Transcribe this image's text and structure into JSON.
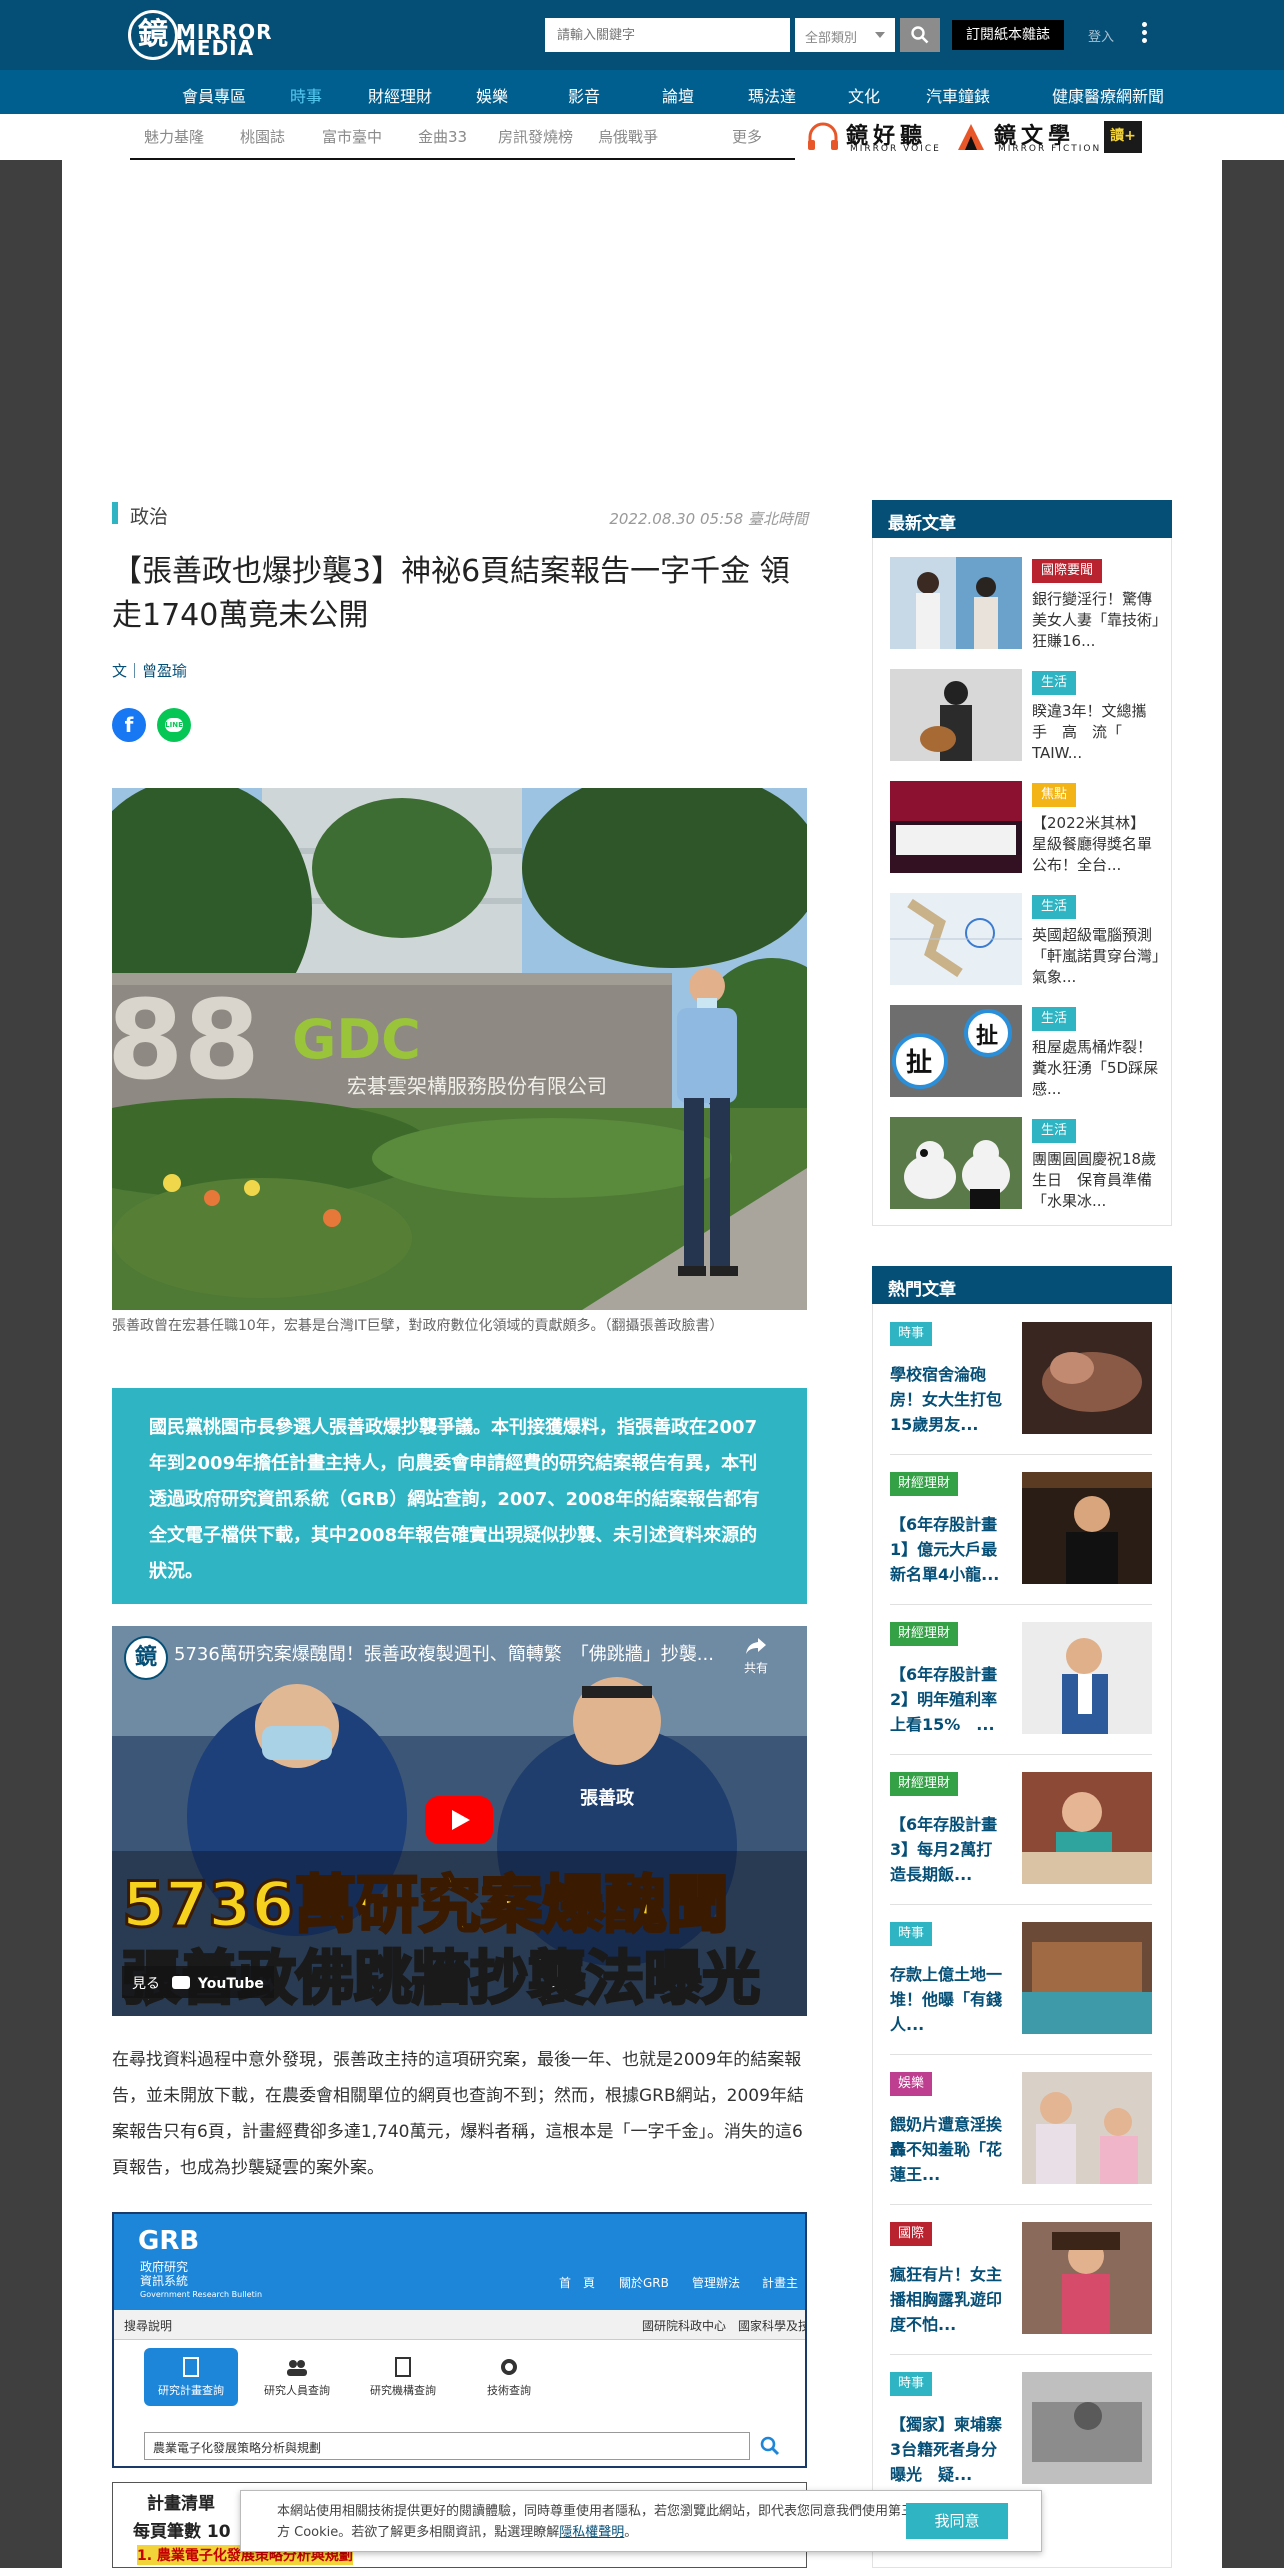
{
  "header": {
    "logo_glyph": "鏡",
    "logo_text": "MIRROR MEDIA",
    "search_placeholder": "請輸入關鍵字",
    "category_value": "全部類別",
    "subscribe_label": "訂閱紙本雜誌",
    "login_label": "登入",
    "icons": {
      "search": "search-icon",
      "more": "more-vertical-icon"
    },
    "colors": {
      "bar": "#054f77",
      "nav": "#015f8f",
      "accent": "#2eb4c3",
      "active_nav": "#55c8f0"
    }
  },
  "category_nav": [
    {
      "label": "會員專區",
      "active": false
    },
    {
      "label": "時事",
      "active": true
    },
    {
      "label": "財經理財",
      "active": false
    },
    {
      "label": "娛樂",
      "active": false
    },
    {
      "label": "影音",
      "active": false
    },
    {
      "label": "論壇",
      "active": false
    },
    {
      "label": "瑪法達",
      "active": false
    },
    {
      "label": "文化",
      "active": false
    },
    {
      "label": "汽車鐘錶",
      "active": false
    },
    {
      "label": "健康醫療網新聞",
      "active": false
    }
  ],
  "sub_nav": [
    "魅力基隆",
    "桃園誌",
    "富市臺中",
    "金曲33",
    "房訊發燒榜",
    "烏俄戰爭",
    "更多"
  ],
  "brands": [
    {
      "zh": "鏡好聽",
      "en": "MIRROR VOICE",
      "icon": "headphones-icon"
    },
    {
      "zh": "鏡文學",
      "en": "MIRROR FICTION",
      "icon": "book-icon"
    }
  ],
  "plus_label": "讀+",
  "article": {
    "section": "政治",
    "published": "2022.08.30 05:58 臺北時間",
    "title": "【張善政也爆抄襲3】神祕6頁結案報告一字千金 領走1740萬竟未公開",
    "byline": "文｜曾盈瑜",
    "share": {
      "facebook": "facebook-icon",
      "line": "line-icon",
      "line_text": "LINE"
    },
    "hero_sign_text": "宏碁雲架構服務股份有限公司",
    "hero_logo_text": "GDC",
    "hero_number": "88",
    "caption": "張善政曾在宏碁任職10年，宏碁是台灣IT巨擘，對政府數位化領域的貢獻頗多。（翻攝張善政臉書）",
    "summary": "國民黨桃園市長參選人張善政爆抄襲爭議。本刊接獲爆料，指張善政在2007年到2009年擔任計畫主持人，向農委會申請經費的研究結案報告有異，本刊透過政府研究資訊系統（GRB）網站查詢，2007、2008年的結案報告都有全文電子檔供下載，其中2008年報告確實出現疑似抄襲、未引述資料來源的狀況。",
    "video": {
      "title": "5736萬研究案爆醜聞！張善政複製週刊、簡轉繁　「佛跳牆」抄襲...",
      "share_label": "共有",
      "headline_1": "5736萬研究案爆醜聞",
      "headline_2": "張善政佛跳牆抄襲法曝光",
      "watch_label": "見る",
      "youtube_label": "YouTube",
      "shirt_text": "張善政"
    },
    "paragraph": "在尋找資料過程中意外發現，張善政主持的這項研究案，最後一年、也就是2009年的結案報告，並未開放下載，在農委會相關單位的網頁也查詢不到；然而，根據GRB網站，2009年結案報告只有6頁，計畫經費卻多達1,740萬元，爆料者稱，這根本是「一字千金」。消失的這6頁報告，也成為抄襲疑雲的案外案。",
    "grb": {
      "logo": "GRB",
      "subtitle_1": "政府研究",
      "subtitle_2": "資訊系統",
      "subtitle_3": "Government Research Bulletin",
      "nav": [
        "首　頁",
        "關於GRB",
        "管理辦法",
        "計畫主"
      ],
      "bar_left": "搜尋說明",
      "bar_right": "國研院科政中心　國家科學及技",
      "tabs": [
        "研究計畫查詢",
        "研究人員查詢",
        "研究機構查詢",
        "技術查詢"
      ],
      "field_value": "農業電子化發展策略分析與規劃",
      "row_1": "計畫清單",
      "row_2": "每頁筆數 10",
      "row_3": "1. 農業電子化發展策略分析與規劃"
    }
  },
  "sidebar": {
    "latest_heading": "最新文章",
    "latest": [
      {
        "badge": "國際要聞",
        "color": "#b8232f",
        "title": "銀行變淫行！驚傳美女人妻「靠技術」狂賺16..."
      },
      {
        "badge": "生活",
        "color": "#2eb4c3",
        "title": "睽違3年！文總攜手　高　流「　TAIW..."
      },
      {
        "badge": "焦點",
        "color": "#f3b418",
        "title": "【2022米其林】星級餐廳得獎名單公布！全台..."
      },
      {
        "badge": "生活",
        "color": "#2eb4c3",
        "title": "英國超級電腦預測「軒嵐諾貫穿台灣」　氣象..."
      },
      {
        "badge": "生活",
        "color": "#2eb4c3",
        "title": "租屋處馬桶炸裂！糞水狂湧「5D踩屎感..."
      },
      {
        "badge": "生活",
        "color": "#2eb4c3",
        "title": "團團圓圓慶祝18歲生日　保育員準備「水果冰..."
      }
    ],
    "hot_heading": "熱門文章",
    "hot": [
      {
        "badge": "時事",
        "color": "#2eb4c3",
        "title": "學校宿舍淪砲房！女大生打包15歲男友..."
      },
      {
        "badge": "財經理財",
        "color": "#35a146",
        "title": "【6年存股計畫1】億元大戶最新名單4小龍..."
      },
      {
        "badge": "財經理財",
        "color": "#35a146",
        "title": "【6年存股計畫2】明年殖利率上看15%　..."
      },
      {
        "badge": "財經理財",
        "color": "#35a146",
        "title": "【6年存股計畫3】每月2萬打造長期飯..."
      },
      {
        "badge": "時事",
        "color": "#2eb4c3",
        "title": "存款上億土地一堆！他曝「有錢人..."
      },
      {
        "badge": "娛樂",
        "color": "#be3f8f",
        "title": "餵奶片遭意淫挨轟不知羞恥「花蓮王..."
      },
      {
        "badge": "國際",
        "color": "#b8232f",
        "title": "瘋狂有片！女主播相胸露乳遊印度不怕..."
      },
      {
        "badge": "時事",
        "color": "#2eb4c3",
        "title": "【獨家】柬埔寨3台籍死者身分曝光　疑..."
      }
    ]
  },
  "cookie": {
    "text": "本網站使用相關技術提供更好的閱讀體驗，同時尊重使用者隱私，若您瀏覽此網站，即代表您同意我們使用第三方 Cookie。若欲了解更多相關資訊，點選理瞭解",
    "link": "隱私權聲明",
    "period": "。",
    "button": "我同意"
  }
}
